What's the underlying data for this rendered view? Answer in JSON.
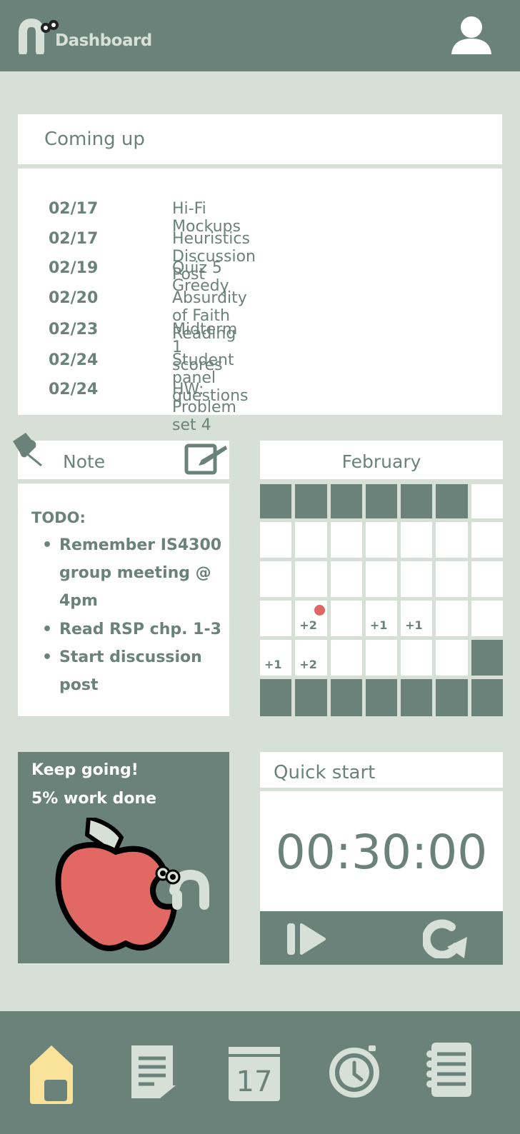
{
  "header": {
    "title": "Dashboard"
  },
  "coming_up": {
    "title": "Coming up",
    "items": [
      {
        "date": "02/17",
        "name": "Hi-Fi Mockups"
      },
      {
        "date": "02/17",
        "name": "Heuristics Discussion Post"
      },
      {
        "date": "02/19",
        "name": "Quiz 5 Greedy"
      },
      {
        "date": "02/20",
        "name": "Absurdity of Faith Reading"
      },
      {
        "date": "02/23",
        "name": "Midterm 1 scores"
      },
      {
        "date": "02/24",
        "name": "Student panel questions"
      },
      {
        "date": "02/24",
        "name": "HW: Problem set 4"
      }
    ]
  },
  "note": {
    "title": "Note",
    "todo_label": "TODO:",
    "items": [
      "Remember IS4300 group meeting @ 4pm",
      "Read RSP chp. 1-3",
      "Start discussion post"
    ]
  },
  "calendar": {
    "month": "February",
    "badges": [
      "+2",
      "+1",
      "+1",
      "+1",
      "+2"
    ]
  },
  "progress": {
    "line1": "Keep going!",
    "line2": "5% work done",
    "percent": 5
  },
  "quick_start": {
    "title": "Quick start",
    "timer": "00:30:00"
  },
  "bottom_nav": {
    "calendar_day": "17",
    "items": [
      "home-icon",
      "notes-icon",
      "calendar-icon",
      "clock-icon",
      "list-icon"
    ],
    "active": "home-icon"
  },
  "colors": {
    "primary": "#6b827a",
    "background": "#d6e0d6",
    "card": "#ffffff",
    "accent_red": "#e06663",
    "accent_yellow": "#f9e39a"
  }
}
